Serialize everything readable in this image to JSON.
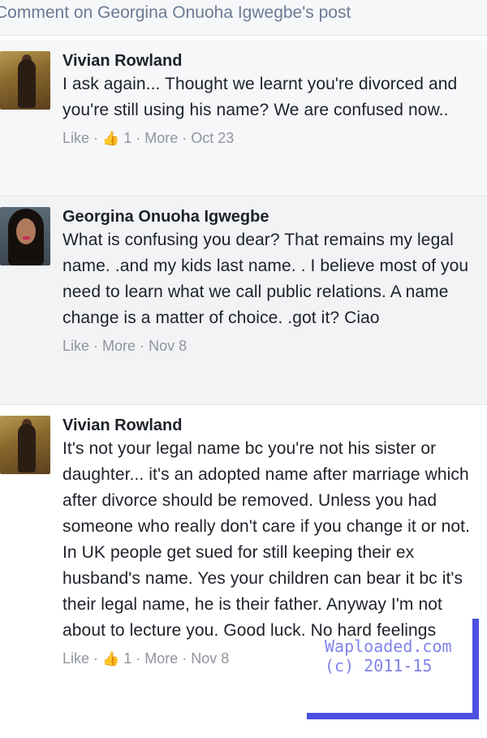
{
  "header": {
    "title": "Comment on Georgina Onuoha Igwegbe's post"
  },
  "comments": [
    {
      "author": "Vivian Rowland",
      "text": "I ask again... Thought we learnt you're divorced and you're still using his name? We are confused now..",
      "like_label": "Like",
      "reaction_icon": "thumbs-up-icon",
      "reaction_count": "1",
      "more_label": "More",
      "timestamp": "Oct 23"
    },
    {
      "author": "Georgina Onuoha Igwegbe",
      "text": "What is confusing you dear? That remains my legal name. .and my kids last name. . I believe most of you need to learn what we call public relations. A name change is a matter of choice. .got it? Ciao",
      "like_label": "Like",
      "more_label": "More",
      "timestamp": "Nov 8"
    },
    {
      "author": "Vivian Rowland",
      "text": "It's not your legal name bc you're not his sister or daughter... it's an adopted name after marriage which after divorce should be removed. Unless you had someone who really don't care if you change it or not. In UK people get sued for still keeping their ex husband's name. Yes your children can bear it bc it's their legal name, he is their father. Anyway I'm not about to lecture you. Good luck. No hard feelings",
      "like_label": "Like",
      "reaction_icon": "thumbs-up-icon",
      "reaction_count": "1",
      "more_label": "More",
      "timestamp": "Nov 8"
    }
  ],
  "watermark": {
    "line1": "Waploaded.com",
    "line2": "(c) 2011-15",
    "color": "#4d4fe0"
  }
}
